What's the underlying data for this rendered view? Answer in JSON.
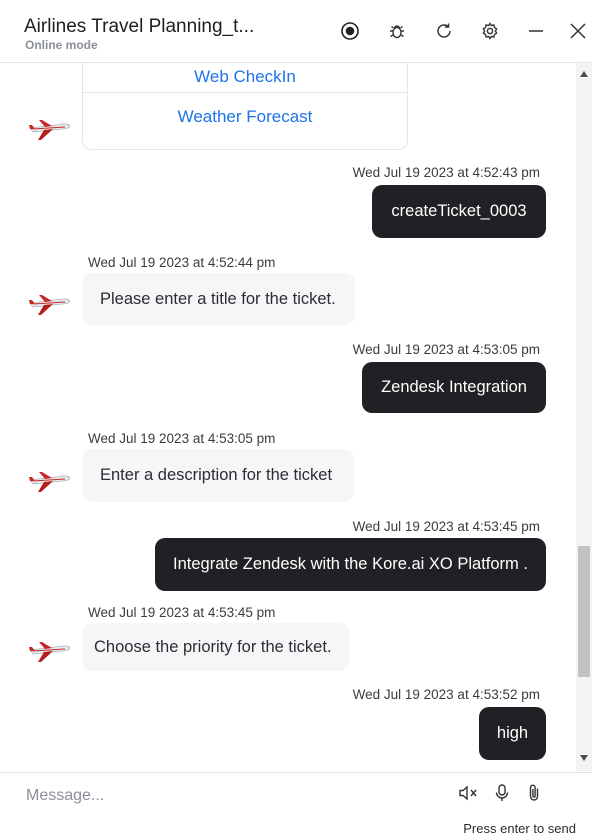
{
  "header": {
    "title": "Airlines Travel Planning_t...",
    "subtitle": "Online mode",
    "icons": [
      "record-icon",
      "bug-icon",
      "refresh-icon",
      "settings-icon",
      "minimize-icon",
      "close-icon"
    ]
  },
  "options": [
    "Web CheckIn",
    "Weather Forecast"
  ],
  "messages": [
    {
      "from": "user",
      "time": "Wed Jul 19 2023 at 4:52:43 pm",
      "text": "createTicket_0003"
    },
    {
      "from": "bot",
      "time": "Wed Jul 19 2023 at 4:52:44 pm",
      "text": "Please enter a title for the ticket."
    },
    {
      "from": "user",
      "time": "Wed Jul 19 2023 at 4:53:05 pm",
      "text": "Zendesk Integration"
    },
    {
      "from": "bot",
      "time": "Wed Jul 19 2023 at 4:53:05 pm",
      "text": "Enter a description for the ticket"
    },
    {
      "from": "user",
      "time": "Wed Jul 19 2023 at 4:53:45 pm",
      "text": "Integrate Zendesk with the Kore.ai XO Platform ."
    },
    {
      "from": "bot",
      "time": "Wed Jul 19 2023 at 4:53:45 pm",
      "text": "Choose the priority for the ticket."
    },
    {
      "from": "user",
      "time": "Wed Jul 19 2023 at 4:53:52 pm",
      "text": "high"
    }
  ],
  "composer": {
    "placeholder": "Message...",
    "hint": "Press enter to send",
    "icons": [
      "speaker-mute-icon",
      "microphone-icon",
      "attachment-icon"
    ]
  },
  "colors": {
    "user_bubble": "#202124",
    "bot_bubble": "#f5f6f8",
    "link": "#1e73e8"
  }
}
